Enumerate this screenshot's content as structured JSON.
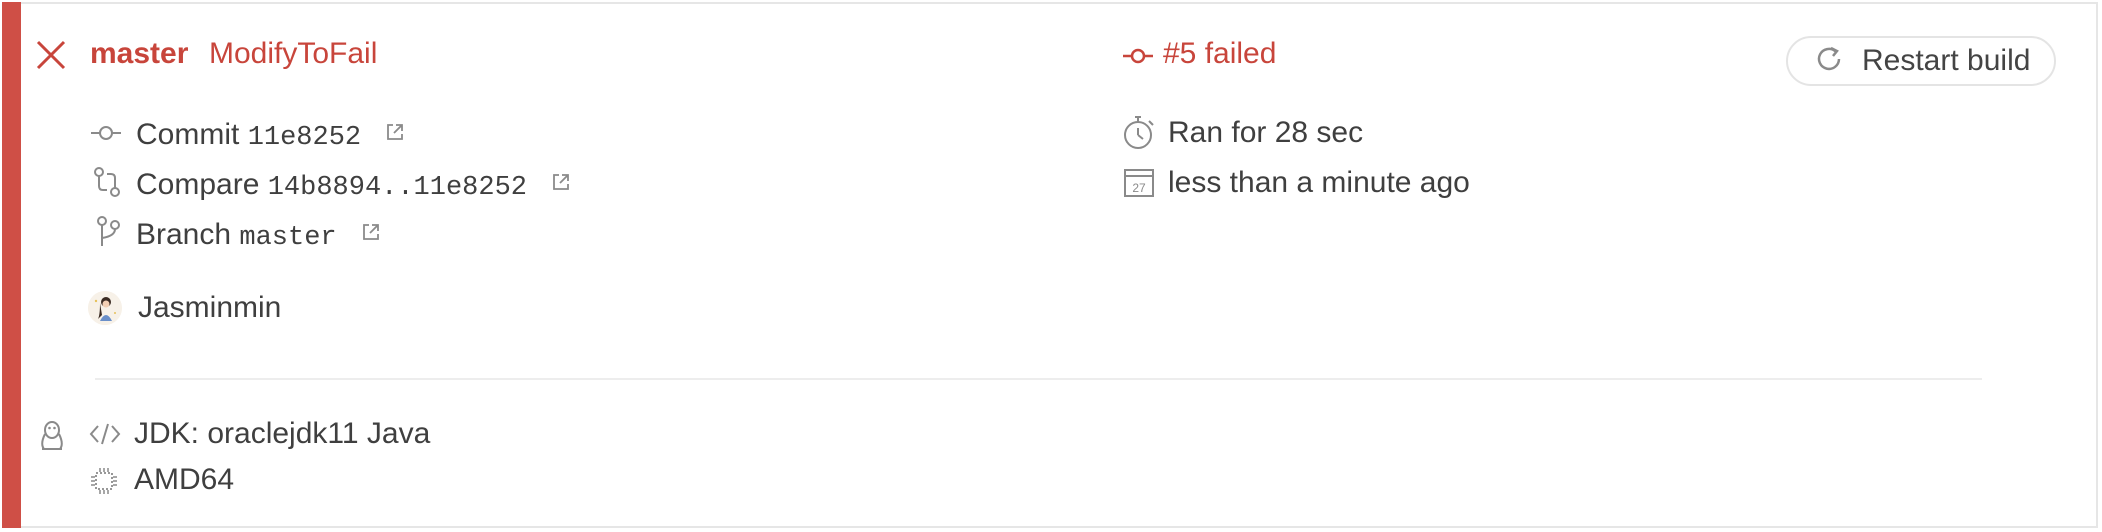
{
  "build": {
    "status_icon": "close-icon",
    "branch_title": "master",
    "commit_message": "ModifyToFail",
    "build_status": "#5 failed",
    "restart_label": "Restart build"
  },
  "details": {
    "commit_label": "Commit",
    "commit_sha": "11e8252",
    "compare_label": "Compare",
    "compare_range": "14b8894..11e8252",
    "branch_label": "Branch",
    "branch_name": "master",
    "author": "Jasminmin",
    "duration": "Ran for 28 sec",
    "finished": "less than a minute ago",
    "calendar_day": "27"
  },
  "job": {
    "os_icon": "linux-penguin-icon",
    "language": "JDK: oraclejdk11 Java",
    "arch": "AMD64"
  },
  "colors": {
    "failed": "#cf4f46",
    "text": "#3f3f3f",
    "icon": "#8a8a8a"
  }
}
